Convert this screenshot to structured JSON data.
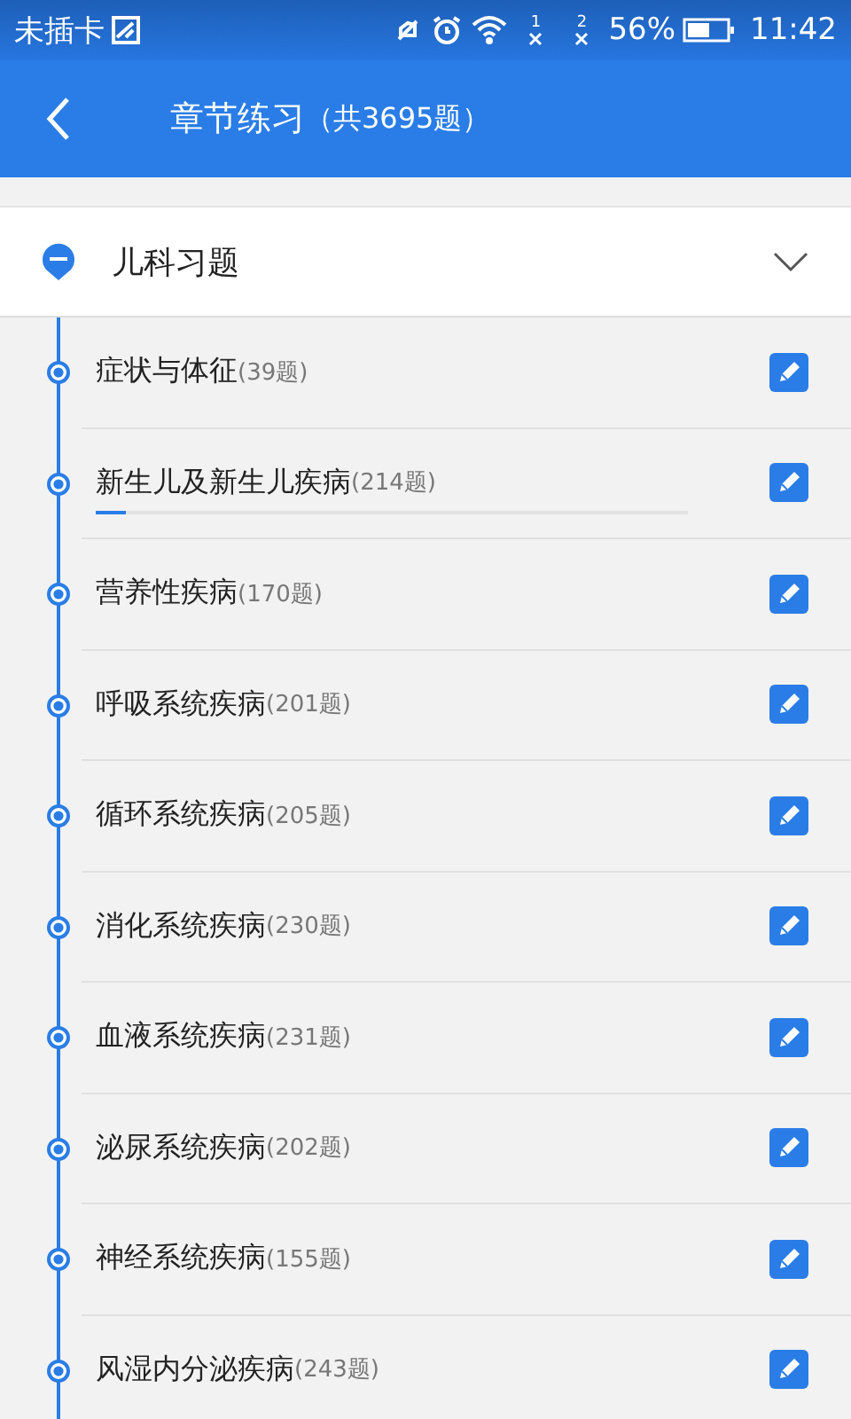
{
  "status_bar": {
    "carrier": "未插卡",
    "sim_slots": [
      "1",
      "2"
    ],
    "battery": "56%",
    "time": "11:42"
  },
  "header": {
    "title": "章节练习",
    "total": "（共3695题）"
  },
  "section": {
    "title": "儿科习题",
    "expanded": true
  },
  "chapters": [
    {
      "name": "症状与体征",
      "count": "(39题)"
    },
    {
      "name": "新生儿及新生儿疾病",
      "count": "(214题)",
      "level": 0.05
    },
    {
      "name": "营养性疾病",
      "count": "(170题)"
    },
    {
      "name": "呼吸系统疾病",
      "count": "(201题)"
    },
    {
      "name": "循环系统疾病",
      "count": "(205题)"
    },
    {
      "name": "消化系统疾病",
      "count": "(230题)"
    },
    {
      "name": "血液系统疾病",
      "count": "(231题)"
    },
    {
      "name": "泌尿系统疾病",
      "count": "(202题)"
    },
    {
      "name": "神经系统疾病",
      "count": "(155题)"
    },
    {
      "name": "风湿内分泌疾病",
      "count": "(243题)"
    }
  ]
}
